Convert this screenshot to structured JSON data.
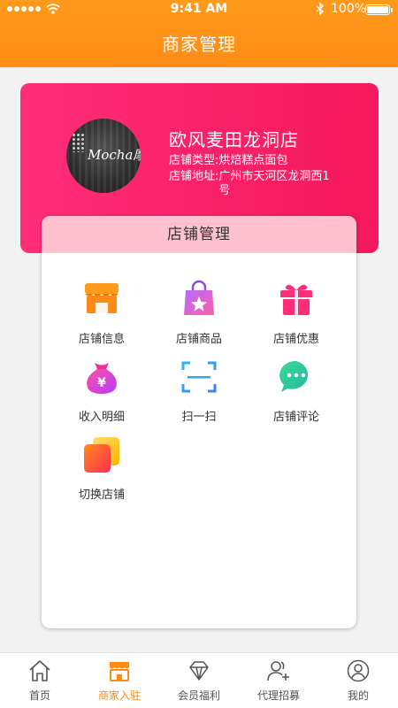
{
  "status_bar": {
    "time": "9:41 AM",
    "battery": "100%"
  },
  "header": {
    "title": "商家管理"
  },
  "store": {
    "avatar_text": "Mocha摩卡",
    "name": "欧风麦田龙洞店",
    "type_label": "店铺类型:",
    "type_value": "烘焙糕点面包",
    "address_label": "店铺地址:",
    "address_value": "广州市天河区龙洞西1号"
  },
  "panel": {
    "title": "店铺管理",
    "items": [
      {
        "label": "店铺信息",
        "icon": "shop-icon"
      },
      {
        "label": "店铺商品",
        "icon": "shopping-bag-icon"
      },
      {
        "label": "店铺优惠",
        "icon": "gift-icon"
      },
      {
        "label": "收入明细",
        "icon": "money-bag-icon"
      },
      {
        "label": "扫一扫",
        "icon": "scan-icon"
      },
      {
        "label": "店铺评论",
        "icon": "comment-icon"
      },
      {
        "label": "切换店铺",
        "icon": "switch-store-icon"
      }
    ]
  },
  "tabbar": {
    "items": [
      {
        "label": "首页",
        "icon": "home-icon"
      },
      {
        "label": "商家入驻",
        "icon": "store-icon",
        "active": true
      },
      {
        "label": "会员福利",
        "icon": "diamond-icon"
      },
      {
        "label": "代理招募",
        "icon": "add-user-icon"
      },
      {
        "label": "我的",
        "icon": "profile-icon"
      }
    ]
  },
  "colors": {
    "header": "#ff9a1a",
    "card": "#f4185c",
    "panel_header": "#ffc0cf",
    "active_tab": "#ff8a14"
  }
}
